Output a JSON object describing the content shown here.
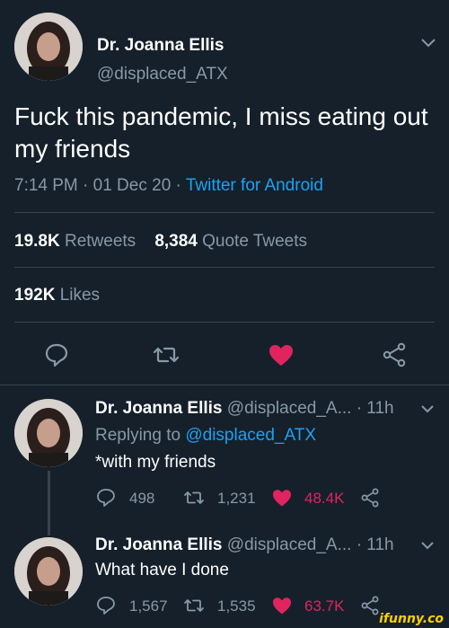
{
  "main_tweet": {
    "author_name": "Dr. Joanna Ellis",
    "author_handle": "@displaced_ATX",
    "text": "Fuck this pandemic, I miss eating out my friends",
    "time": "7:14 PM · 01 Dec 20 · ",
    "source": "Twitter for Android",
    "retweets_count": "19.8K",
    "retweets_label": "Retweets",
    "quote_count": "8,384",
    "quote_label": "Quote Tweets",
    "likes_count": "192K",
    "likes_label": "Likes",
    "liked": true
  },
  "replies": [
    {
      "author_name": "Dr. Joanna Ellis",
      "author_handle": "@displaced_A...",
      "age": "· 11h",
      "replying_prefix": "Replying to",
      "replying_to": "@displaced_ATX",
      "text": "*with my friends",
      "reply_count": "498",
      "retweet_count": "1,231",
      "like_count": "48.4K"
    },
    {
      "author_name": "Dr. Joanna Ellis",
      "author_handle": "@displaced_A...",
      "age": "· 11h",
      "text": "What have I done",
      "reply_count": "1,567",
      "retweet_count": "1,535",
      "like_count": "63.7K"
    }
  ],
  "watermark": "ifunny.co",
  "colors": {
    "background": "#15202b",
    "accent": "#1da1f2",
    "like": "#e0245e",
    "muted": "#8899a6",
    "divider": "#38444d"
  },
  "icons": [
    "chevron-down-icon",
    "reply-icon",
    "retweet-icon",
    "heart-icon",
    "share-icon"
  ]
}
